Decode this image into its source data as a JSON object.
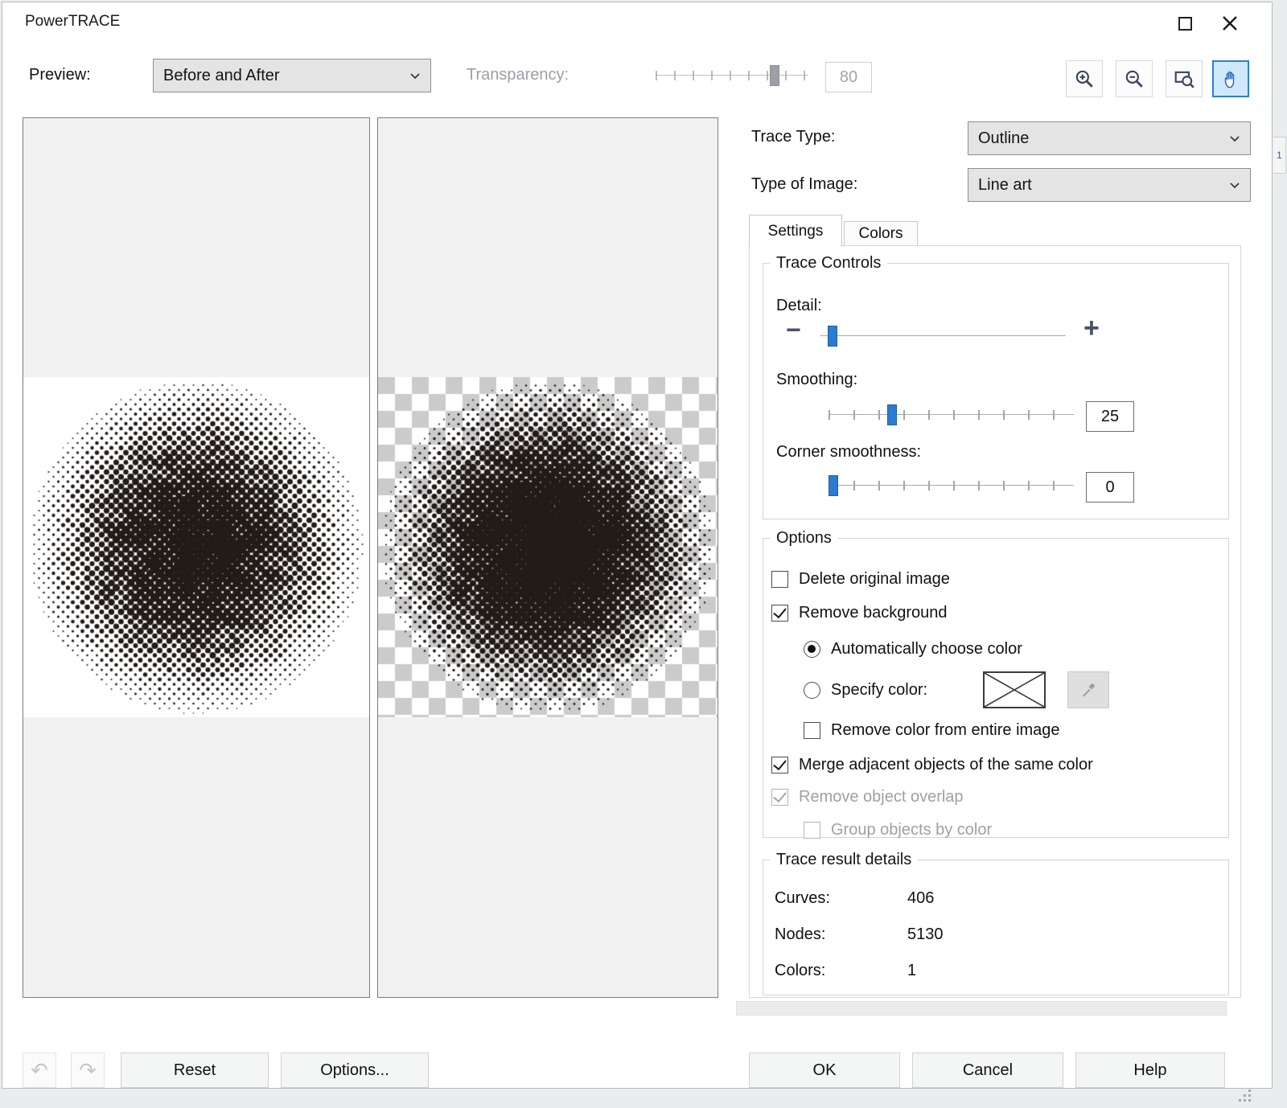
{
  "window": {
    "title": "PowerTRACE"
  },
  "toolbar": {
    "preview_label": "Preview:",
    "preview_value": "Before and After",
    "transparency_label": "Transparency:",
    "transparency_value": "80"
  },
  "trace_type": {
    "label": "Trace Type:",
    "value": "Outline"
  },
  "image_type": {
    "label": "Type of Image:",
    "value": "Line art"
  },
  "tabs": {
    "settings": "Settings",
    "colors": "Colors"
  },
  "trace_controls": {
    "legend": "Trace Controls",
    "detail_label": "Detail:",
    "smoothing_label": "Smoothing:",
    "smoothing_value": "25",
    "corner_label": "Corner smoothness:",
    "corner_value": "0"
  },
  "options": {
    "legend": "Options",
    "delete_original": "Delete original image",
    "remove_background": "Remove background",
    "auto_color": "Automatically choose color",
    "specify_color": "Specify color:",
    "remove_color_entire": "Remove color from entire image",
    "merge_adjacent": "Merge adjacent objects of the same color",
    "remove_overlap": "Remove object overlap",
    "group_by_color": "Group objects by color"
  },
  "result": {
    "legend": "Trace result details",
    "curves_label": "Curves:",
    "curves_value": "406",
    "nodes_label": "Nodes:",
    "nodes_value": "5130",
    "colors_label": "Colors:",
    "colors_value": "1"
  },
  "footer": {
    "reset": "Reset",
    "options": "Options...",
    "ok": "OK",
    "cancel": "Cancel",
    "help": "Help"
  },
  "side_tab": {
    "label": "1"
  },
  "icons": {
    "minus_glyph": "−",
    "plus_glyph": "+",
    "undo_glyph": "↶",
    "redo_glyph": "↷",
    "names": [
      "maximize",
      "close",
      "zoom-in-magnifier",
      "zoom-out-magnifier",
      "zoom-to-fit",
      "pan-hand",
      "chevron-down",
      "eyedropper",
      "no-color-swatch",
      "undo-arrow",
      "redo-arrow",
      "resize-grip"
    ]
  },
  "states": {
    "delete_original": false,
    "remove_background": true,
    "auto_color": true,
    "specify_color": false,
    "remove_color_entire": false,
    "merge_adjacent": true,
    "remove_overlap": true,
    "group_by_color": false
  },
  "sliders": {
    "transparency": 80,
    "detail": 3,
    "smoothing": 25,
    "corner": 0
  },
  "colors": {
    "accent": "#2a7fd4",
    "selected_tool_bg": "#cfe8fb",
    "slider_thumb": "#2b7bd3",
    "halftone_ink": "#221b18",
    "checker_gray": "#cbcbcb"
  }
}
